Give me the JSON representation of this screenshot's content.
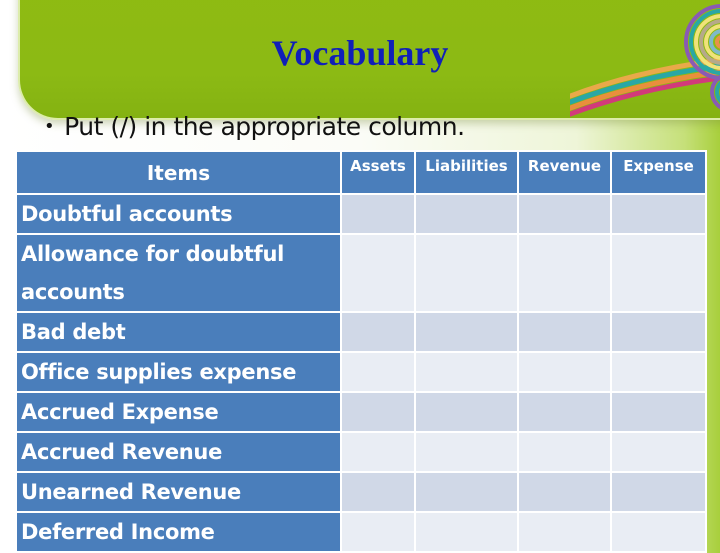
{
  "slide": {
    "title": "Vocabulary",
    "bullet": "Put (/) in the appropriate column.",
    "title_color": "#1020b8",
    "banner_color": "#8cba14"
  },
  "table": {
    "headers": [
      "Items",
      "Assets",
      "Liabilities",
      "Revenue",
      "Expense"
    ],
    "rows": [
      {
        "item": "Doubtful accounts",
        "cells": [
          "",
          "",
          "",
          ""
        ]
      },
      {
        "item": "Allowance for doubtful accounts",
        "cells": [
          "",
          "",
          "",
          ""
        ]
      },
      {
        "item": "Bad debt",
        "cells": [
          "",
          "",
          "",
          ""
        ]
      },
      {
        "item": "Office supplies expense",
        "cells": [
          "",
          "",
          "",
          ""
        ]
      },
      {
        "item": "Accrued Expense",
        "cells": [
          "",
          "",
          "",
          ""
        ]
      },
      {
        "item": "Accrued Revenue",
        "cells": [
          "",
          "",
          "",
          ""
        ]
      },
      {
        "item": "Unearned Revenue",
        "cells": [
          "",
          "",
          "",
          ""
        ]
      },
      {
        "item": "Deferred Income",
        "cells": [
          "",
          "",
          "",
          ""
        ]
      }
    ],
    "header_color": "#4a7ebb",
    "row_color_odd": "#d0d8e7",
    "row_color_even": "#e9edf4"
  }
}
